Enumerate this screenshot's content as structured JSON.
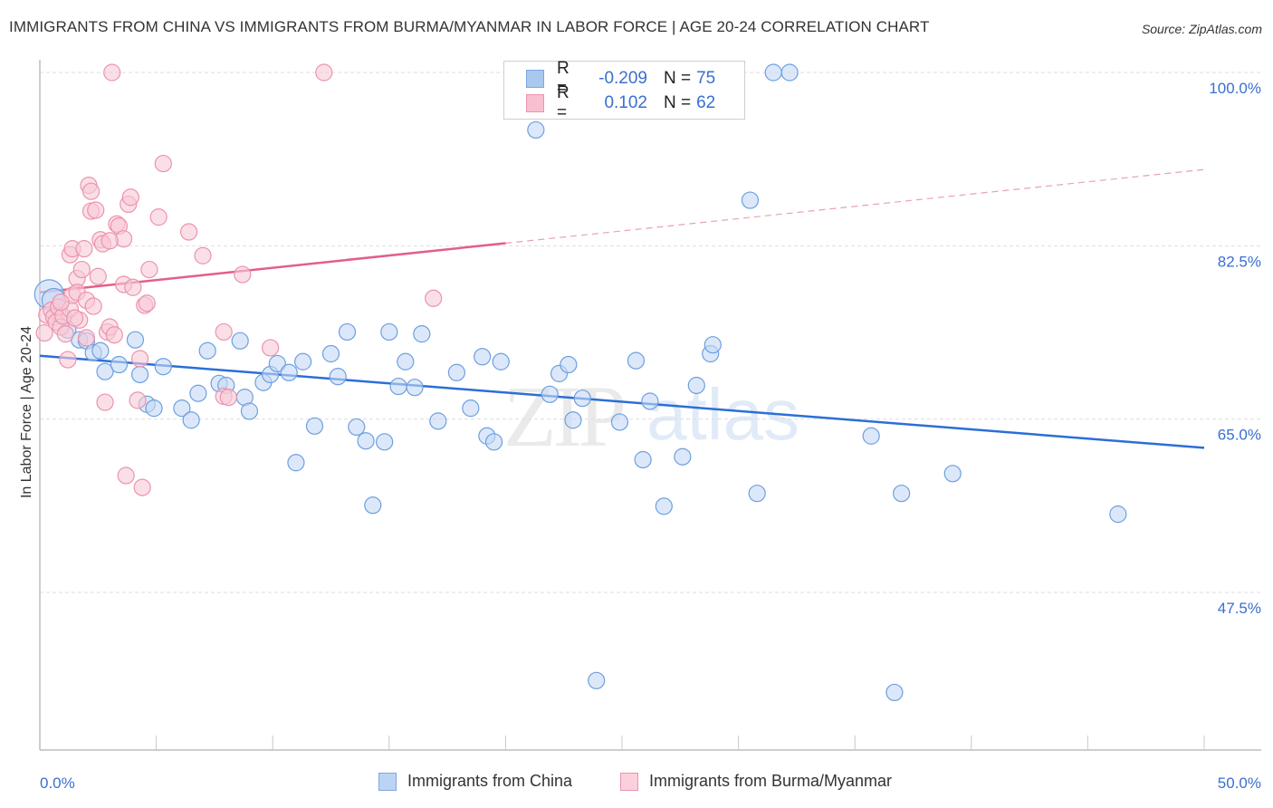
{
  "header": {
    "title": "IMMIGRANTS FROM CHINA VS IMMIGRANTS FROM BURMA/MYANMAR IN LABOR FORCE | AGE 20-24 CORRELATION CHART",
    "source": "Source: ZipAtlas.com"
  },
  "watermark": {
    "part1": "ZIP",
    "part2": "atlas"
  },
  "legend": {
    "rows": [
      {
        "r_label": "R =",
        "r_value": "-0.209",
        "n_label": "N =",
        "n_value": "75",
        "color": "#a9c8f0",
        "border": "#7ea6e0"
      },
      {
        "r_label": "R =",
        "r_value": "0.102",
        "n_label": "N =",
        "n_value": "62",
        "color": "#f8bfd0",
        "border": "#eb93ad"
      }
    ]
  },
  "bottom_legend": {
    "items": [
      {
        "label": "Immigrants from China",
        "color": "#a9c8f0",
        "border": "#7ea6e0"
      },
      {
        "label": "Immigrants from Burma/Myanmar",
        "color": "#f8bfd0",
        "border": "#eb93ad"
      }
    ]
  },
  "chart_data": {
    "type": "scatter",
    "title": "IMMIGRANTS FROM CHINA VS IMMIGRANTS FROM BURMA/MYANMAR IN LABOR FORCE | AGE 20-24 CORRELATION CHART",
    "xlabel": "",
    "ylabel": "In Labor Force | Age 20-24",
    "xlim": [
      0,
      50
    ],
    "ylim": [
      30,
      101.5
    ],
    "x_tick_labels": [
      "0.0%",
      "50.0%"
    ],
    "y_ticks": [
      100.0,
      82.5,
      65.0,
      47.5
    ],
    "y_tick_labels": [
      "100.0%",
      "82.5%",
      "65.0%",
      "47.5%"
    ],
    "grid": true,
    "legend_position": "top-center",
    "series": [
      {
        "name": "Immigrants from China",
        "color": "#6d9fe0",
        "fill": "#c5d9f5",
        "R": -0.209,
        "N": 75,
        "trend": {
          "x0": 0,
          "y0": 71.4,
          "x1": 50,
          "y1": 62.1,
          "dashed_from": null
        },
        "points": [
          [
            0.4,
            77.6
          ],
          [
            0.6,
            77.0
          ],
          [
            0.9,
            75.5
          ],
          [
            1.2,
            74.0
          ],
          [
            1.7,
            73.0
          ],
          [
            2.0,
            72.9
          ],
          [
            2.3,
            71.7
          ],
          [
            2.6,
            71.9
          ],
          [
            2.8,
            69.8
          ],
          [
            3.4,
            70.5
          ],
          [
            4.1,
            73.0
          ],
          [
            4.3,
            69.5
          ],
          [
            4.6,
            66.5
          ],
          [
            4.9,
            66.1
          ],
          [
            5.3,
            70.3
          ],
          [
            6.1,
            66.1
          ],
          [
            6.5,
            64.9
          ],
          [
            6.8,
            67.6
          ],
          [
            7.2,
            71.9
          ],
          [
            7.7,
            68.6
          ],
          [
            8.0,
            68.4
          ],
          [
            8.6,
            72.9
          ],
          [
            8.8,
            67.2
          ],
          [
            9.0,
            65.8
          ],
          [
            9.6,
            68.7
          ],
          [
            9.9,
            69.5
          ],
          [
            10.2,
            70.6
          ],
          [
            10.7,
            69.7
          ],
          [
            11.0,
            60.6
          ],
          [
            11.3,
            70.8
          ],
          [
            11.8,
            64.3
          ],
          [
            12.5,
            71.6
          ],
          [
            12.8,
            69.3
          ],
          [
            13.2,
            73.8
          ],
          [
            13.6,
            64.2
          ],
          [
            14.0,
            62.8
          ],
          [
            14.3,
            56.3
          ],
          [
            14.8,
            62.7
          ],
          [
            15.0,
            73.8
          ],
          [
            15.4,
            68.3
          ],
          [
            15.7,
            70.8
          ],
          [
            16.1,
            68.2
          ],
          [
            16.4,
            73.6
          ],
          [
            17.1,
            64.8
          ],
          [
            17.9,
            69.7
          ],
          [
            18.5,
            66.1
          ],
          [
            19.0,
            71.3
          ],
          [
            19.2,
            63.3
          ],
          [
            19.5,
            62.7
          ],
          [
            19.8,
            70.8
          ],
          [
            21.3,
            94.2
          ],
          [
            21.9,
            67.5
          ],
          [
            22.3,
            69.6
          ],
          [
            22.7,
            70.5
          ],
          [
            22.9,
            64.9
          ],
          [
            23.3,
            67.1
          ],
          [
            23.9,
            38.6
          ],
          [
            24.9,
            64.7
          ],
          [
            25.6,
            70.9
          ],
          [
            25.9,
            60.9
          ],
          [
            26.2,
            66.8
          ],
          [
            26.8,
            56.2
          ],
          [
            27.6,
            61.2
          ],
          [
            28.2,
            68.4
          ],
          [
            28.8,
            71.6
          ],
          [
            28.9,
            72.5
          ],
          [
            30.5,
            87.1
          ],
          [
            30.8,
            57.5
          ],
          [
            31.5,
            100.0
          ],
          [
            32.2,
            100.0
          ],
          [
            35.7,
            63.3
          ],
          [
            37.0,
            57.5
          ],
          [
            36.7,
            37.4
          ],
          [
            39.2,
            59.5
          ],
          [
            46.3,
            55.4
          ]
        ]
      },
      {
        "name": "Immigrants from Burma/Myanmar",
        "color": "#eb93ad",
        "fill": "#f8c9d7",
        "R": 0.102,
        "N": 62,
        "trend": {
          "x0": 0,
          "y0": 77.8,
          "x1": 50,
          "y1": 90.2,
          "solid_until_x": 20
        },
        "points": [
          [
            0.2,
            73.7
          ],
          [
            0.3,
            75.5
          ],
          [
            0.5,
            76.0
          ],
          [
            0.6,
            75.3
          ],
          [
            0.7,
            74.8
          ],
          [
            0.8,
            76.3
          ],
          [
            0.9,
            74.3
          ],
          [
            1.0,
            75.4
          ],
          [
            1.1,
            73.6
          ],
          [
            1.2,
            71.0
          ],
          [
            1.3,
            76.1
          ],
          [
            1.4,
            77.5
          ],
          [
            1.3,
            81.6
          ],
          [
            1.4,
            82.2
          ],
          [
            1.6,
            79.2
          ],
          [
            1.6,
            77.8
          ],
          [
            1.7,
            75.0
          ],
          [
            1.8,
            80.1
          ],
          [
            1.9,
            82.2
          ],
          [
            2.0,
            77.0
          ],
          [
            2.1,
            88.6
          ],
          [
            2.2,
            88.0
          ],
          [
            2.2,
            86.0
          ],
          [
            2.4,
            86.1
          ],
          [
            2.5,
            79.4
          ],
          [
            2.6,
            83.1
          ],
          [
            2.7,
            82.7
          ],
          [
            2.8,
            66.7
          ],
          [
            2.9,
            73.8
          ],
          [
            3.0,
            74.3
          ],
          [
            3.1,
            100.0
          ],
          [
            3.2,
            73.5
          ],
          [
            3.3,
            84.7
          ],
          [
            3.4,
            84.5
          ],
          [
            3.6,
            78.6
          ],
          [
            3.6,
            83.2
          ],
          [
            3.7,
            59.3
          ],
          [
            3.8,
            86.7
          ],
          [
            3.9,
            87.4
          ],
          [
            4.0,
            78.3
          ],
          [
            4.2,
            66.9
          ],
          [
            4.3,
            71.1
          ],
          [
            4.4,
            58.1
          ],
          [
            4.5,
            76.5
          ],
          [
            4.6,
            76.7
          ],
          [
            4.7,
            80.1
          ],
          [
            5.1,
            85.4
          ],
          [
            5.3,
            90.8
          ],
          [
            6.4,
            83.9
          ],
          [
            7.0,
            81.5
          ],
          [
            7.9,
            73.8
          ],
          [
            7.9,
            67.3
          ],
          [
            8.1,
            67.2
          ],
          [
            8.7,
            79.6
          ],
          [
            9.9,
            72.2
          ],
          [
            12.2,
            100.0
          ],
          [
            16.9,
            77.2
          ],
          [
            2.3,
            76.4
          ],
          [
            0.9,
            76.8
          ],
          [
            1.5,
            75.2
          ],
          [
            2.0,
            73.2
          ],
          [
            3.0,
            83.0
          ]
        ]
      }
    ]
  }
}
